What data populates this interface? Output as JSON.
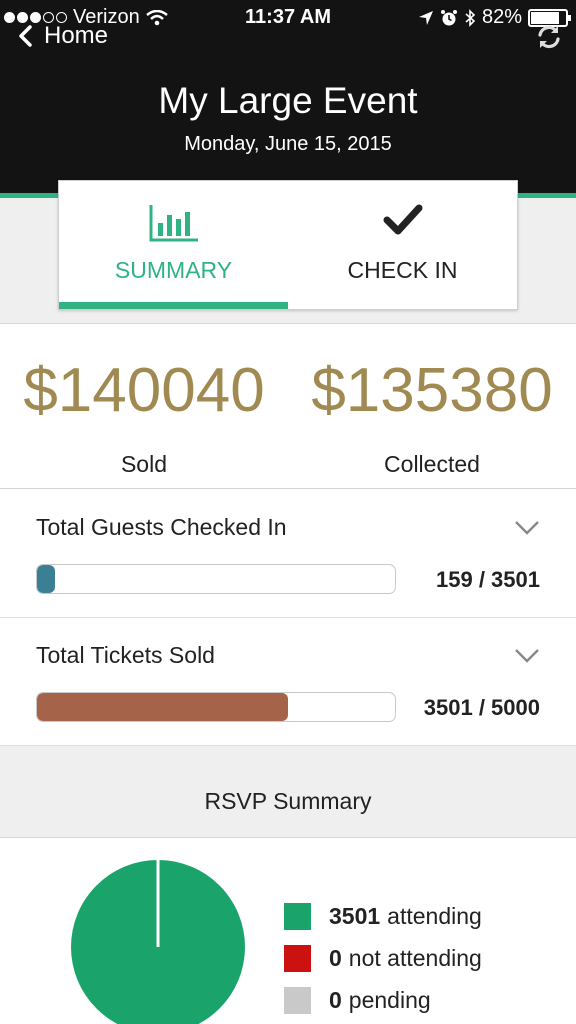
{
  "status_bar": {
    "carrier": "Verizon",
    "time": "11:37 AM",
    "battery": "82%",
    "battery_level": 0.82
  },
  "nav": {
    "back_label": "Home",
    "back_icon": "chevron-left-icon",
    "refresh_icon": "refresh-icon"
  },
  "event": {
    "title": "My Large Event",
    "date": "Monday, June 15, 2015"
  },
  "tabs": [
    {
      "label": "SUMMARY",
      "icon": "bar-chart-icon",
      "active": true
    },
    {
      "label": "CHECK IN",
      "icon": "checkmark-icon",
      "active": false
    }
  ],
  "totals": {
    "sold_amount": "$140040",
    "sold_label": "Sold",
    "collected_amount": "$135380",
    "collected_label": "Collected"
  },
  "progress": {
    "guests": {
      "title": "Total Guests Checked In",
      "value_text": "159 / 3501",
      "current": 159,
      "total": 3501,
      "fill_color": "#3b7f95"
    },
    "tickets": {
      "title": "Total Tickets Sold",
      "value_text": "3501 / 5000",
      "current": 3501,
      "total": 5000,
      "fill_color": "#a5644a"
    }
  },
  "rsvp": {
    "title": "RSVP Summary",
    "legend": [
      {
        "count": "3501",
        "label": "attending",
        "color": "#1aa36b"
      },
      {
        "count": "0",
        "label": "not attending",
        "color": "#cc1111"
      },
      {
        "count": "0",
        "label": "pending",
        "color": "#c9c9c9"
      }
    ]
  },
  "colors": {
    "accent": "#2fb383",
    "amount": "#a08a52",
    "header_bg": "#131313"
  }
}
